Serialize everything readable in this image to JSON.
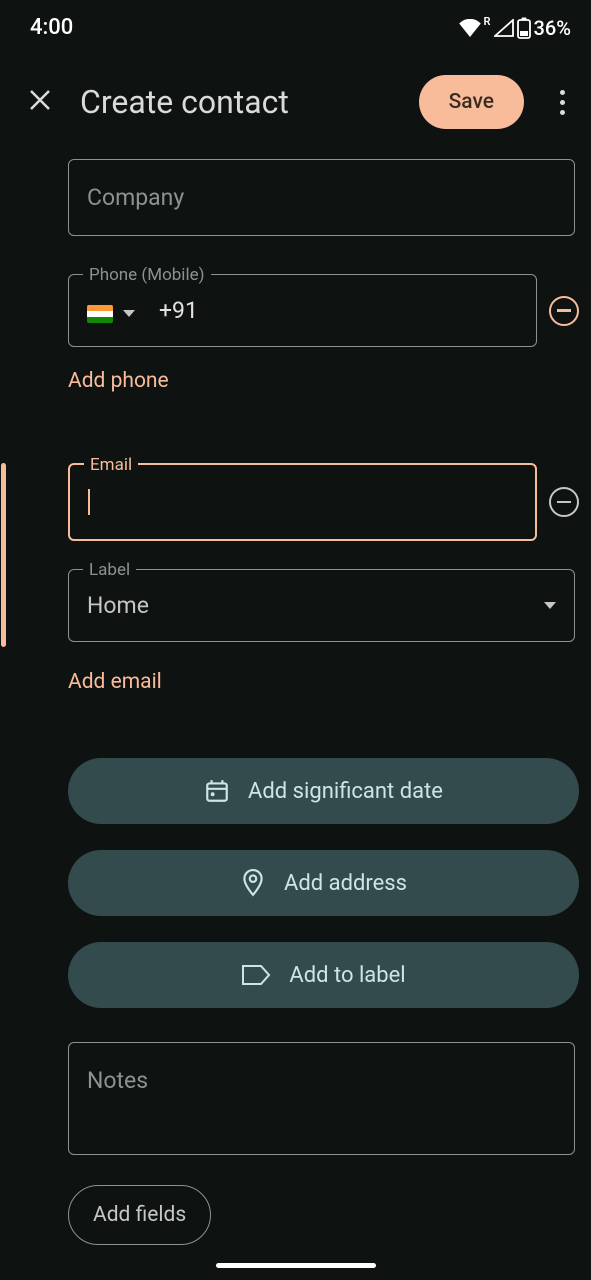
{
  "status": {
    "time": "4:00",
    "roaming": "R",
    "battery": "36%"
  },
  "header": {
    "title": "Create contact",
    "save": "Save"
  },
  "fields": {
    "company_placeholder": "Company",
    "phone_label": "Phone (Mobile)",
    "phone_prefix": "+91",
    "email_label": "Email",
    "label_label": "Label",
    "label_value": "Home",
    "notes_placeholder": "Notes"
  },
  "links": {
    "add_phone": "Add phone",
    "add_email": "Add email",
    "add_date": "Add significant date",
    "add_address": "Add address",
    "add_label": "Add to label",
    "add_fields": "Add fields"
  },
  "colors": {
    "accent": "#f9bc9b",
    "teal": "#344b4d"
  }
}
